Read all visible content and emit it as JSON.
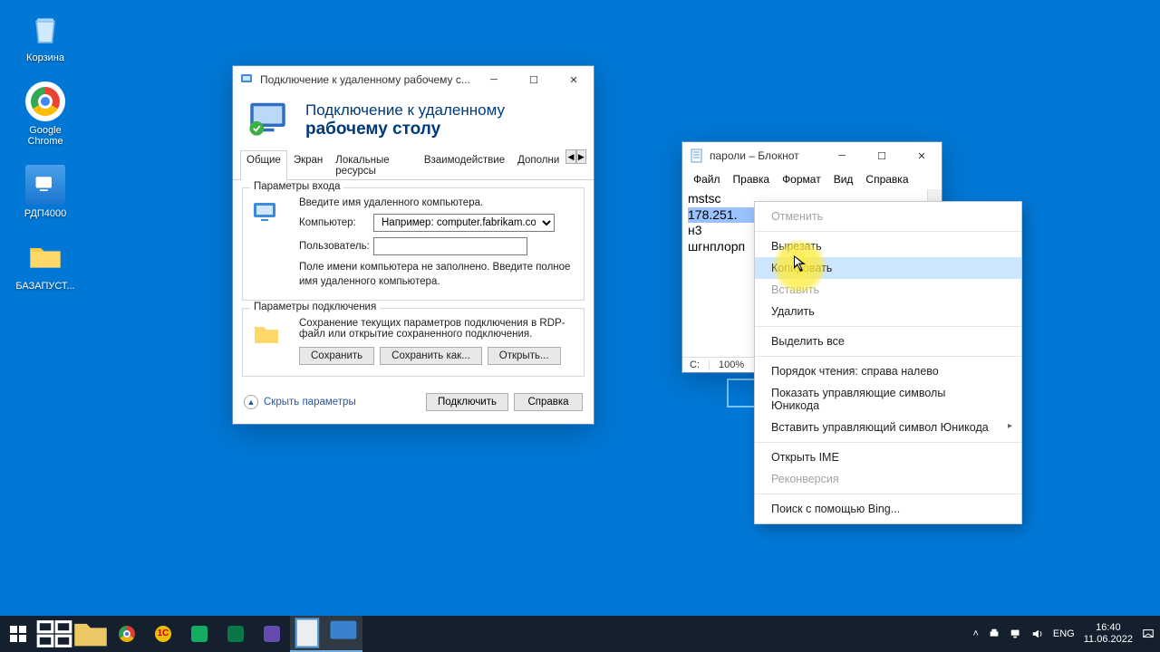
{
  "desktop": {
    "icons": [
      {
        "name": "recycle-bin",
        "label": "Корзина"
      },
      {
        "name": "google-chrome",
        "label": "Google Chrome"
      },
      {
        "name": "rdp-shortcut",
        "label": "РДП4000"
      },
      {
        "name": "folder-bazapust",
        "label": "БАЗАПУСТ..."
      }
    ]
  },
  "rdp": {
    "window_title": "Подключение к удаленному рабочему с...",
    "header_line1": "Подключение к удаленному",
    "header_line2": "рабочему столу",
    "tabs": [
      "Общие",
      "Экран",
      "Локальные ресурсы",
      "Взаимодействие",
      "Дополни"
    ],
    "login_group": {
      "legend": "Параметры входа",
      "prompt": "Введите имя удаленного компьютера.",
      "computer_label": "Компьютер:",
      "computer_placeholder": "Например: computer.fabrikam.com",
      "user_label": "Пользователь:",
      "help": "Поле имени компьютера не заполнено. Введите полное имя удаленного компьютера."
    },
    "conn_group": {
      "legend": "Параметры подключения",
      "text": "Сохранение текущих параметров подключения в RDP-файл или открытие сохраненного подключения.",
      "save": "Сохранить",
      "save_as": "Сохранить как...",
      "open": "Открыть..."
    },
    "footer": {
      "hide": "Скрыть параметры",
      "connect": "Подключить",
      "help": "Справка"
    }
  },
  "notepad": {
    "title": "пароли – Блокнот",
    "menus": [
      "Файл",
      "Правка",
      "Формат",
      "Вид",
      "Справка"
    ],
    "lines": [
      "mstsc",
      "178.251.",
      "н3",
      "шгнплорп"
    ],
    "selected_line_index": 1,
    "status": {
      "col_label": "С:",
      "col_value": "100%"
    }
  },
  "context_menu": {
    "items": [
      {
        "label": "Отменить",
        "state": "disabled"
      },
      {
        "sep": true
      },
      {
        "label": "Вырезать",
        "state": "normal"
      },
      {
        "label": "Копировать",
        "state": "hover"
      },
      {
        "label": "Вставить",
        "state": "disabled"
      },
      {
        "label": "Удалить",
        "state": "normal"
      },
      {
        "sep": true
      },
      {
        "label": "Выделить все",
        "state": "normal"
      },
      {
        "sep": true
      },
      {
        "label": "Порядок чтения: справа налево",
        "state": "normal"
      },
      {
        "label": "Показать управляющие символы Юникода",
        "state": "normal"
      },
      {
        "label": "Вставить управляющий символ Юникода",
        "state": "normal",
        "submenu": true
      },
      {
        "sep": true
      },
      {
        "label": "Открыть IME",
        "state": "normal"
      },
      {
        "label": "Реконверсия",
        "state": "disabled"
      },
      {
        "sep": true
      },
      {
        "label": "Поиск с помощью Bing...",
        "state": "normal"
      }
    ]
  },
  "taskbar": {
    "tray": {
      "lang": "ENG",
      "time": "16:40",
      "date": "11.06.2022"
    }
  }
}
